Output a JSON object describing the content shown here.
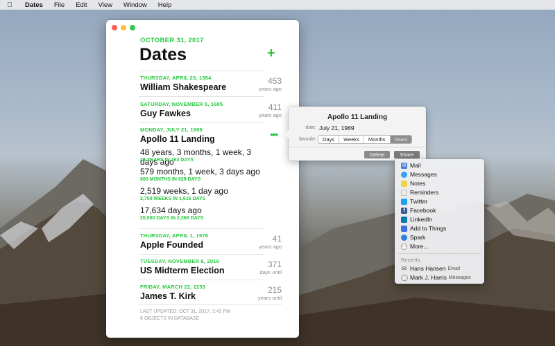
{
  "menubar": {
    "apple": "",
    "items": [
      "Dates",
      "File",
      "Edit",
      "View",
      "Window",
      "Help"
    ]
  },
  "window": {
    "header_date": "OCTOBER 31, 2017",
    "title": "Dates",
    "add_label": "+",
    "entries": [
      {
        "date": "THURSDAY, APRIL 23, 1564",
        "name": "William Shakespeare",
        "number": "453",
        "unit": "years ago"
      },
      {
        "date": "SATURDAY, NOVEMBER 5, 1605",
        "name": "Guy Fawkes",
        "number": "411",
        "unit": "years ago"
      },
      {
        "date": "MONDAY, JULY 21, 1969",
        "name": "Apollo 11 Landing",
        "more": "•••",
        "durations": [
          {
            "main": "48 years, 3 months, 1 week, 3 days ago",
            "sub": "49 YEARS IN 263 DAYS"
          },
          {
            "main": "579 months, 1 week, 3 days ago",
            "sub": "600 MONTHS IN 628 DAYS"
          },
          {
            "main": "2,519 weeks, 1 day ago",
            "sub": "2,750 WEEKS IN 1,616 DAYS"
          },
          {
            "main": "17,634 days ago",
            "sub": "20,000 DAYS IN 2,366 DAYS"
          }
        ]
      },
      {
        "date": "THURSDAY, APRIL 1, 1976",
        "name": "Apple Founded",
        "number": "41",
        "unit": "years ago"
      },
      {
        "date": "TUESDAY, NOVEMBER 6, 2018",
        "name": "US Midterm Election",
        "number": "371",
        "unit": "days until"
      },
      {
        "date": "FRIDAY, MARCH 22, 2233",
        "name": "James T. Kirk",
        "number": "215",
        "unit": "years until"
      }
    ],
    "footer": {
      "updated": "LAST UPDATED: OCT 31, 2017, 1:43 PM",
      "count": "6 OBJECTS IN DATABASE"
    }
  },
  "popover": {
    "title": "Apollo 11 Landing",
    "date_label": "date:",
    "date_value": "July 21, 1969",
    "favorite_label": "favorite:",
    "segments": [
      "Days",
      "Weeks",
      "Months",
      "Years"
    ],
    "selected_segment": "Years",
    "delete_label": "Delete",
    "share_label": "Share"
  },
  "share_menu": {
    "items": [
      {
        "label": "Mail",
        "icon": "mail-icon",
        "color": "#4a7fd4"
      },
      {
        "label": "Messages",
        "icon": "messages-icon",
        "color": "#3aa0f0"
      },
      {
        "label": "Notes",
        "icon": "notes-icon",
        "color": "#f3d04a"
      },
      {
        "label": "Reminders",
        "icon": "reminders-icon",
        "color": "#eeeeee"
      },
      {
        "label": "Twitter",
        "icon": "twitter-icon",
        "color": "#1da1f2"
      },
      {
        "label": "Facebook",
        "icon": "facebook-icon",
        "color": "#3b5998"
      },
      {
        "label": "LinkedIn",
        "icon": "linkedin-icon",
        "color": "#0077b5"
      },
      {
        "label": "Add to Things",
        "icon": "things-icon",
        "color": "#3f6fd9"
      },
      {
        "label": "Spark",
        "icon": "spark-icon",
        "color": "#2d7fe0"
      },
      {
        "label": "More...",
        "icon": "more-icon",
        "color": "#9a9a9a"
      }
    ],
    "recents_label": "Recents",
    "recents": [
      {
        "name": "Hans Hansen",
        "via": "Email",
        "icon": "envelope-icon"
      },
      {
        "name": "Mark J. Harris",
        "via": "Messages",
        "icon": "speech-bubble-icon"
      }
    ]
  }
}
